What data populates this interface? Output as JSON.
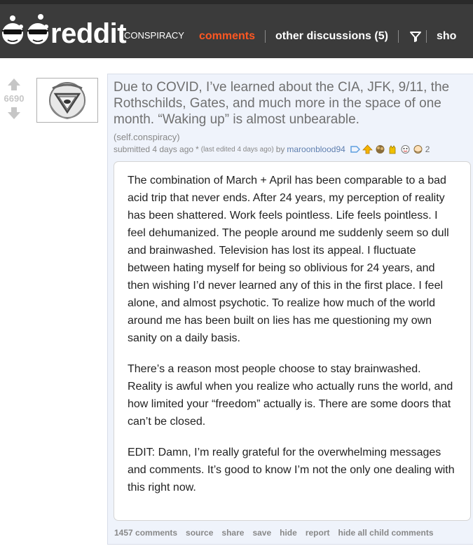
{
  "header": {
    "logo_text": "reddit",
    "subreddit": "CONSPIRACY",
    "tabs": [
      {
        "label": "comments",
        "active": true
      },
      {
        "label": "other discussions (5)",
        "active": false
      },
      {
        "label": "sho",
        "active": false
      }
    ],
    "filter_icon": "filter-icon",
    "colors": {
      "bar": "#3b3b3b",
      "active_tab": "#ff5722"
    }
  },
  "post": {
    "score": "6690",
    "title": "Due to COVID, I’ve learned about the CIA, JFK, 9/11, the Rothschilds, Gates, and much more in the space of one month. “Waking up” is almost unbearable.",
    "domain": "(self.conspiracy)",
    "tagline": {
      "submitted": "submitted 4 days ago",
      "star": "*",
      "edited": "(last edited 4 days ago)",
      "by": "by",
      "author": "maroonblood94",
      "award_count": "2"
    },
    "body": [
      "The combination of March + April has been comparable to a bad acid trip that never ends. After 24 years, my perception of reality has been shattered. Work feels pointless. Life feels pointless. I feel dehumanized. The people around me suddenly seem so dull and brainwashed. Television has lost its appeal. I fluctuate between hating myself for being so oblivious for 24 years, and then wishing I’d never learned any of this in the first place. I feel alone, and almost psychotic. To realize how much of the world around me has been built on lies has me questioning my own sanity on a daily basis.",
      "There’s a reason most people choose to stay brainwashed. Reality is awful when you realize who actually runs the world, and how limited your “freedom” actually is. There are some doors that can’t be closed.",
      "EDIT: Damn, I’m really grateful for the overwhelming messages and comments. It’s good to know I’m not the only one dealing with this right now."
    ],
    "buttons": {
      "comments": "1457 comments",
      "source": "source",
      "share": "share",
      "save": "save",
      "hide": "hide",
      "report": "report",
      "hide_children": "hide all child comments"
    }
  }
}
